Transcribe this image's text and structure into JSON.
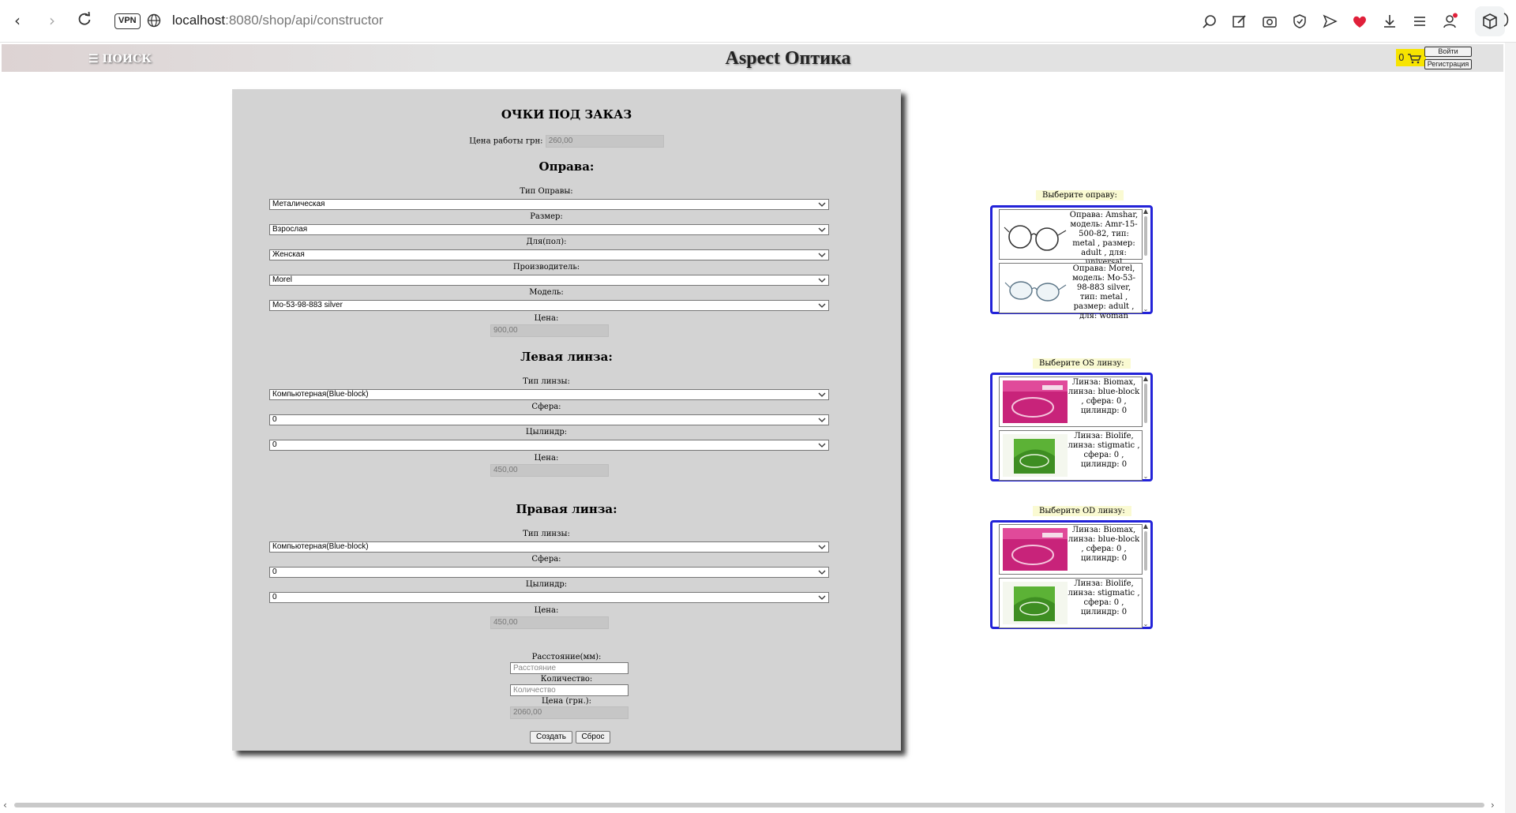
{
  "browser": {
    "vpn_label": "VPN",
    "url_host": "localhost",
    "url_rest": ":8080/shop/api/constructor"
  },
  "header": {
    "menu_label": "☰ ПОИСК",
    "site_title": "Aspect Оптика",
    "cart_count": "0",
    "login_label": "Войти",
    "register_label": "Регистрация"
  },
  "form": {
    "title": "ОЧКИ ПОД ЗАКАЗ",
    "work_price_label": "Цена работы грн:",
    "work_price_value": "260,00",
    "frame": {
      "heading": "Оправа:",
      "type_label": "Тип Оправы:",
      "type_value": "Металическая",
      "size_label": "Размер:",
      "size_value": "Взрослая",
      "gender_label": "Для(пол):",
      "gender_value": "Женская",
      "maker_label": "Производитель:",
      "maker_value": "Morel",
      "model_label": "Модель:",
      "model_value": "Mo-53-98-883 silver",
      "price_label": "Цена:",
      "price_value": "900,00"
    },
    "left_lens": {
      "heading": "Левая линза:",
      "type_label": "Тип линзы:",
      "type_value": "Компьютерная(Blue-block)",
      "sphere_label": "Сфера:",
      "sphere_value": "0",
      "cylinder_label": "Цылиндр:",
      "cylinder_value": "0",
      "price_label": "Цена:",
      "price_value": "450,00"
    },
    "right_lens": {
      "heading": "Правая линза:",
      "type_label": "Тип линзы:",
      "type_value": "Компьютерная(Blue-block)",
      "sphere_label": "Сфера:",
      "sphere_value": "0",
      "cylinder_label": "Цылиндр:",
      "cylinder_value": "0",
      "price_label": "Цена:",
      "price_value": "450,00"
    },
    "distance_label": "Расстояние(мм):",
    "distance_placeholder": "Расстояние",
    "quantity_label": "Количество:",
    "quantity_placeholder": "Количество",
    "total_label": "Цена (грн.):",
    "total_value": "2060,00",
    "create_label": "Создать",
    "reset_label": "Сброс"
  },
  "pickers": {
    "frame": {
      "caption": "Выберите оправу:",
      "items": [
        "Оправа: Amshar, модель: Amr-15-500-82, тип: metal , размер: adult , для: universal",
        "Оправа: Morel, модель: Mo-53-98-883 silver, тип: metal , размер: adult , для: woman"
      ]
    },
    "os_lens": {
      "caption": "Выберите OS линзу:",
      "items": [
        "Линза: Biomax, линза: blue-block , сфера: 0 , цилиндр: 0",
        "Линза: Biolife, линза: stigmatic , сфера: 0 , цилиндр: 0"
      ]
    },
    "od_lens": {
      "caption": "Выберите OD линзу:",
      "items": [
        "Линза: Biomax, линза: blue-block , сфера: 0 , цилиндр: 0",
        "Линза: Biolife, линза: stigmatic , сфера: 0 , цилиндр: 0"
      ]
    }
  }
}
